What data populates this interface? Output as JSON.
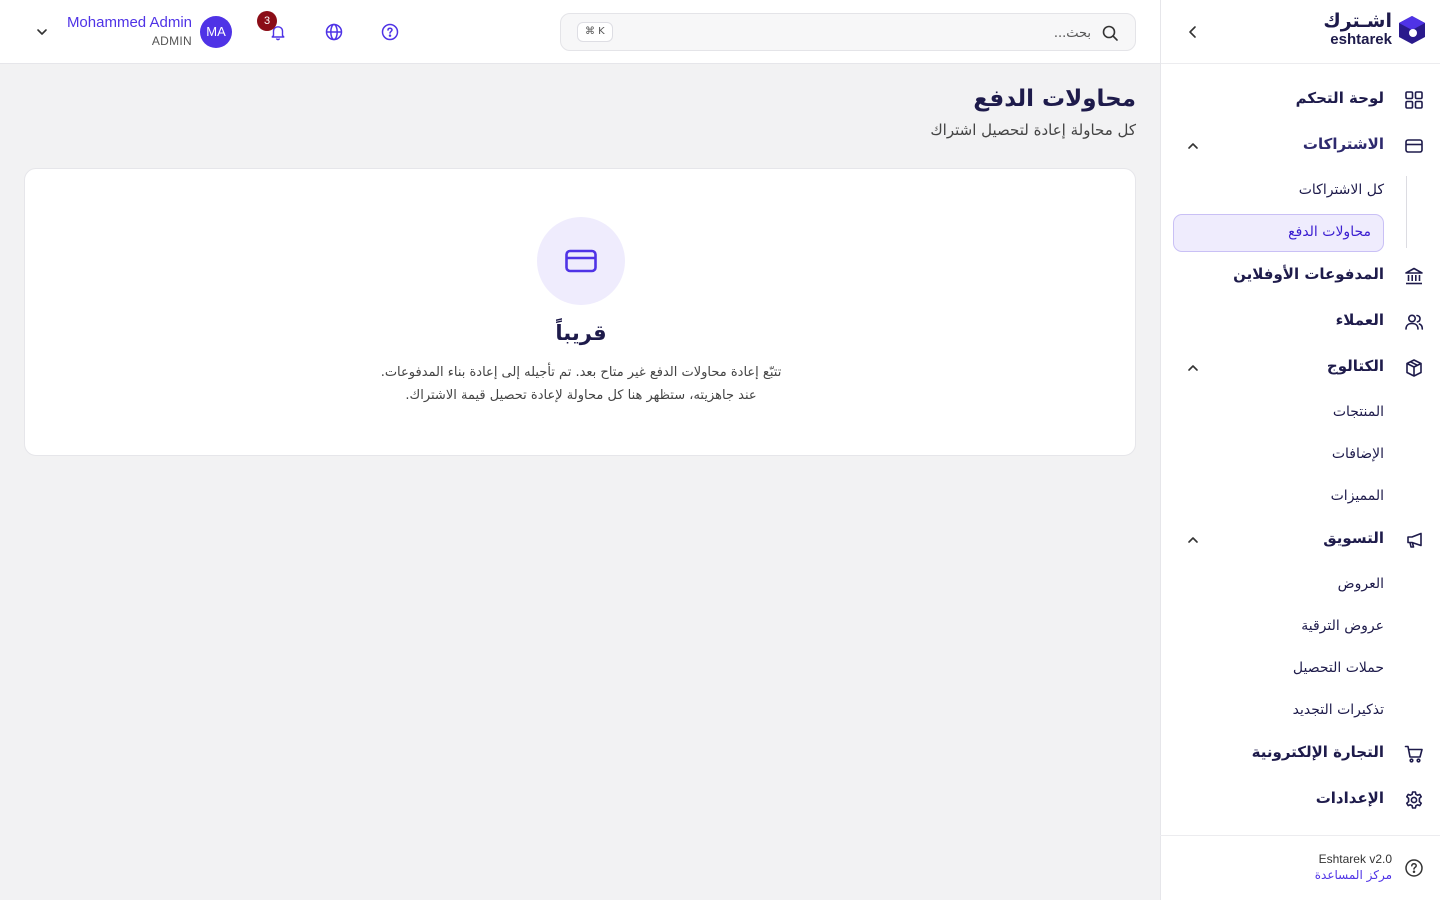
{
  "brand": {
    "name_ar": "اشـترك",
    "name_en": "eshtarek",
    "primary_color": "#4f33e6",
    "dark_color": "#1e1b4b"
  },
  "sidebar": {
    "items": [
      {
        "label": "لوحة التحكم",
        "icon": "dashboard-grid-icon"
      },
      {
        "label": "الاشتراكات",
        "icon": "credit-card-icon",
        "expanded": true,
        "children": [
          {
            "label": "كل الاشتراكات"
          },
          {
            "label": "محاولات الدفع",
            "active": true
          }
        ]
      },
      {
        "label": "المدفوعات الأوفلاين",
        "icon": "bank-icon"
      },
      {
        "label": "العملاء",
        "icon": "users-icon"
      },
      {
        "label": "الكتالوج",
        "icon": "package-icon",
        "expanded": true,
        "children": [
          {
            "label": "المنتجات"
          },
          {
            "label": "الإضافات"
          },
          {
            "label": "المميزات"
          }
        ]
      },
      {
        "label": "التسويق",
        "icon": "megaphone-icon",
        "expanded": true,
        "children": [
          {
            "label": "العروض"
          },
          {
            "label": "عروض الترقية"
          },
          {
            "label": "حملات التحصيل"
          },
          {
            "label": "تذكيرات التجديد"
          }
        ]
      },
      {
        "label": "التجارة الإلكترونية",
        "icon": "shopping-cart-icon"
      },
      {
        "label": "الإعدادات",
        "icon": "gear-icon"
      }
    ],
    "footer": {
      "version": "Eshtarek v2.0",
      "help_link": "مركز المساعدة"
    }
  },
  "topbar": {
    "search_placeholder": "بحث...",
    "shortcut": "⌘ K",
    "notifications_count": "3",
    "user": {
      "name": "Mohammed Admin",
      "role": "ADMIN",
      "initials": "MA"
    }
  },
  "main": {
    "title": "محاولات الدفع",
    "subtitle": "كل محاولة إعادة لتحصيل اشتراك",
    "empty_state": {
      "icon": "credit-card-icon",
      "title": "قريباً",
      "line1": "تتبّع إعادة محاولات الدفع غير متاح بعد. تم تأجيله إلى إعادة بناء المدفوعات.",
      "line2": "عند جاهزيته، ستظهر هنا كل محاولة لإعادة تحصيل قيمة الاشتراك."
    }
  }
}
